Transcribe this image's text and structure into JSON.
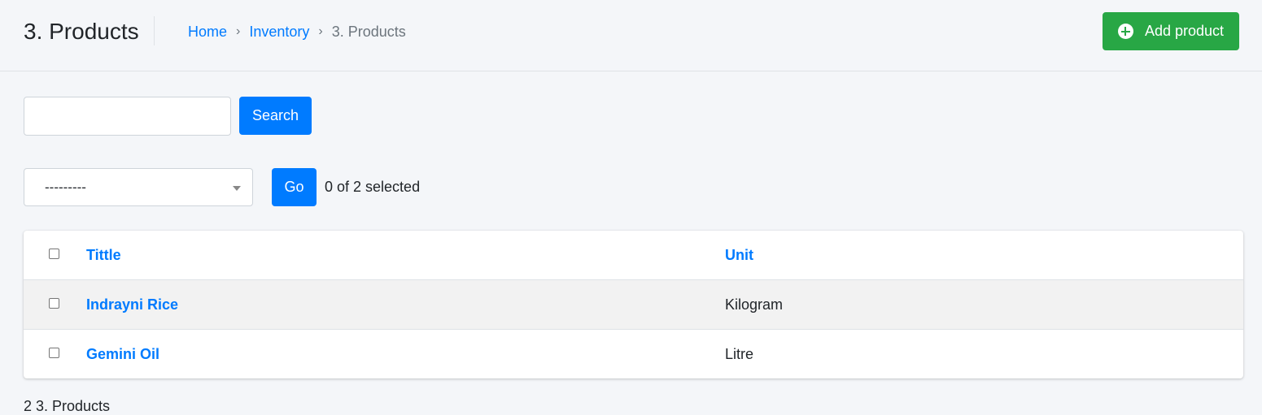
{
  "header": {
    "title": "3. Products",
    "breadcrumb": {
      "home": "Home",
      "inventory": "Inventory",
      "current": "3. Products",
      "separator": "›"
    },
    "add_button_label": "Add product",
    "add_button_icon": "plus-circle-icon"
  },
  "search": {
    "value": "",
    "button_label": "Search"
  },
  "actions": {
    "select_value": "---------",
    "go_label": "Go",
    "selected_text": "0 of 2 selected"
  },
  "table": {
    "columns": [
      "Tittle",
      "Unit"
    ],
    "rows": [
      {
        "title": "Indrayni Rice",
        "unit": "Kilogram"
      },
      {
        "title": "Gemini Oil",
        "unit": "Litre"
      }
    ]
  },
  "footer": {
    "text": "2 3. Products"
  },
  "colors": {
    "primary": "#007bff",
    "success": "#28a745",
    "background": "#f4f6f9"
  }
}
